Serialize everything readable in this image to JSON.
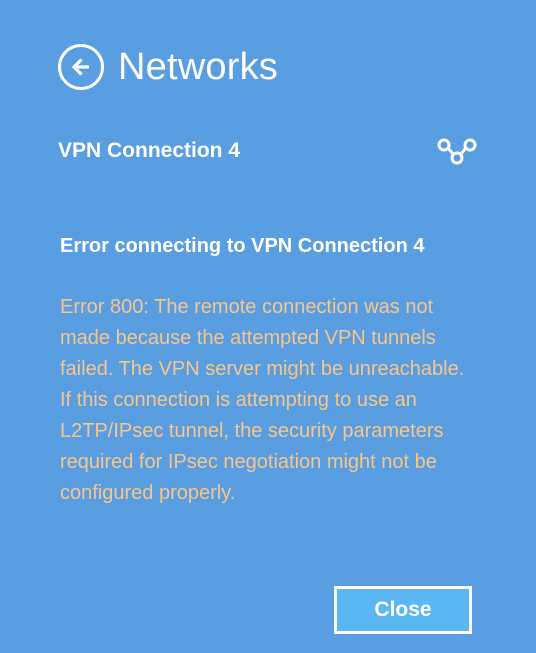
{
  "panel": {
    "title": "Networks",
    "back_icon": "back-arrow-circle-icon"
  },
  "connection": {
    "name": "VPN Connection 4",
    "icon": "vpn-key-icon"
  },
  "error": {
    "title": "Error connecting to VPN Connection 4",
    "message": "Error 800: The remote connection was not made because the attempted VPN tunnels failed. The VPN server might be unreachable. If this connection is attempting to use an L2TP/IPsec tunnel, the security parameters required for IPsec negotiation might not be configured properly."
  },
  "actions": {
    "close_label": "Close"
  },
  "colors": {
    "background": "#599ee0",
    "text": "#ffffff",
    "error_text": "#f7c48a",
    "button_fill": "#5bb7f2"
  }
}
